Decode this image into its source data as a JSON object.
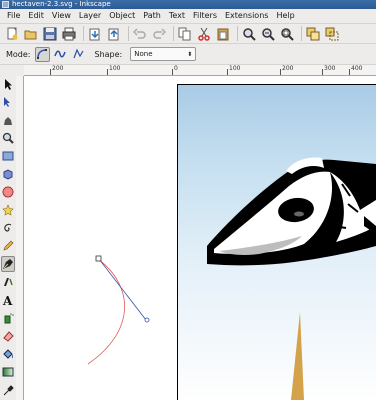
{
  "window": {
    "title": "hectaven-2.3.svg - Inkscape"
  },
  "menu": [
    "File",
    "Edit",
    "View",
    "Layer",
    "Object",
    "Path",
    "Text",
    "Filters",
    "Extensions",
    "Help"
  ],
  "toolbar": {
    "icons": [
      "new-document",
      "open",
      "save",
      "print",
      "import",
      "export",
      "undo",
      "redo",
      "copy",
      "cut",
      "paste",
      "zoom-selection",
      "zoom-drawing",
      "zoom-page",
      "duplicate",
      "clone",
      "unlink-clone"
    ]
  },
  "controls": {
    "mode_label": "Mode:",
    "shape_label": "Shape:",
    "shape_value": "None",
    "modes": [
      "bezier-mode",
      "spiro-mode",
      "polyline-mode"
    ]
  },
  "ruler": {
    "labels": [
      "200",
      "100",
      "0",
      "100",
      "200",
      "300",
      "400"
    ]
  },
  "tools": [
    "selector",
    "node",
    "tweak",
    "zoom",
    "rectangle",
    "3d-box",
    "ellipse",
    "star",
    "spiral",
    "pencil",
    "pen",
    "calligraphy",
    "text",
    "spray",
    "eraser",
    "bucket",
    "gradient",
    "dropper"
  ],
  "colors": {
    "accent": "#2c5a94",
    "sky_top": "#a9cbe6",
    "ship_body": "#ffffff",
    "ship_outline": "#000000",
    "spire": "#d4a24a"
  }
}
